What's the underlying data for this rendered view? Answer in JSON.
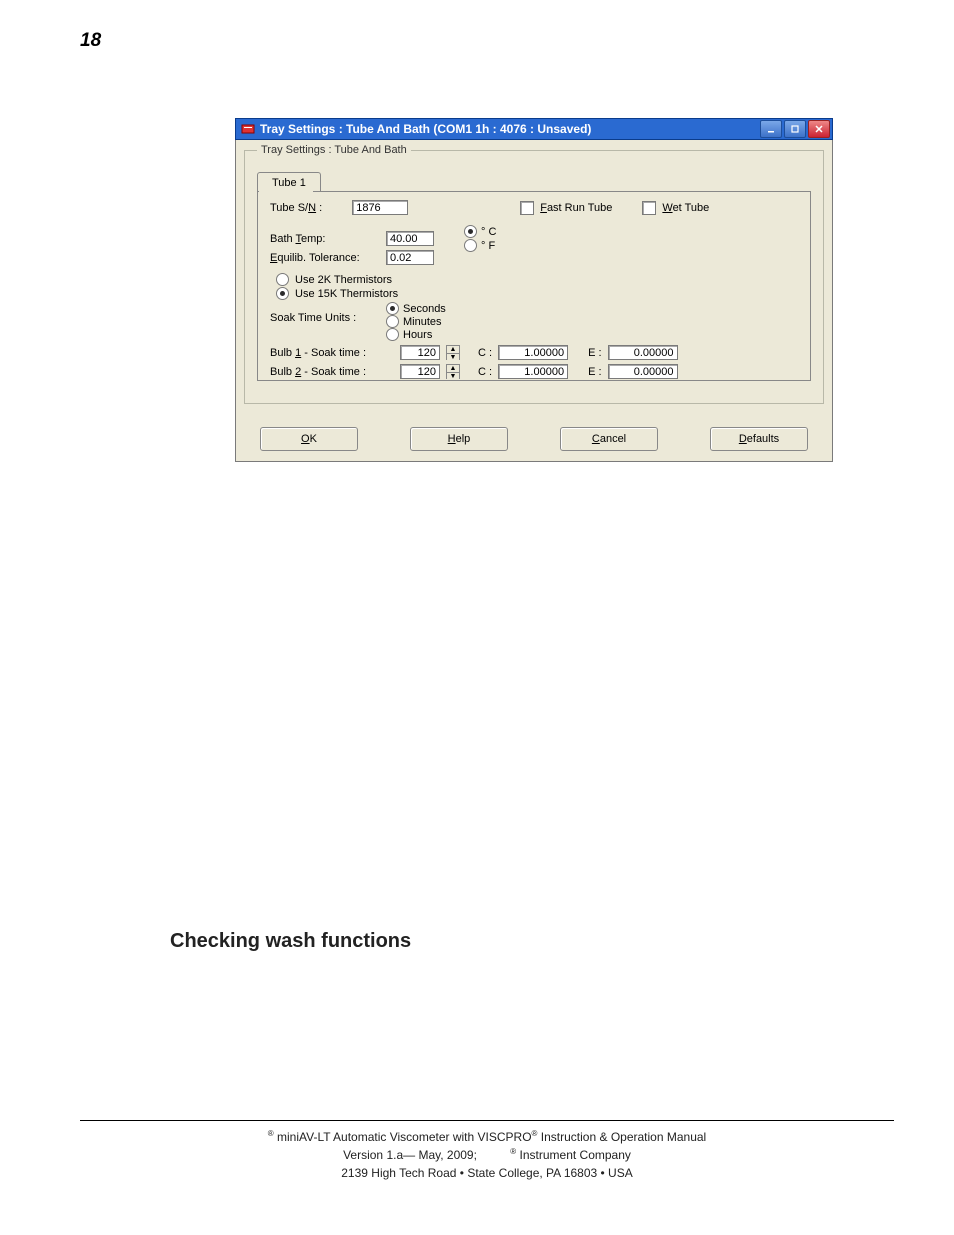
{
  "page_number": "18",
  "window": {
    "title": "Tray Settings : Tube And Bath (COM1 1h : 4076 : Unsaved)"
  },
  "fieldset_legend": "Tray Settings : Tube And Bath",
  "tab_label": "Tube 1",
  "tube_sn": {
    "label_plain": "Tube S/",
    "label_u": "N",
    "label_after": " :",
    "value": "1876"
  },
  "fast_run": {
    "u": "F",
    "rest": "ast Run Tube"
  },
  "wet_tube": {
    "u": "W",
    "rest": "et Tube"
  },
  "bath_temp": {
    "label_pre": "Bath ",
    "u": "T",
    "label_post": "emp:",
    "value": "40.00"
  },
  "temp_unit_c": "° C",
  "temp_unit_f": "° F",
  "equilib": {
    "u": "E",
    "rest": "quilib. Tolerance:",
    "value": "0.02"
  },
  "therm_2k": "Use 2K Thermistors",
  "therm_15k": "Use 15K Thermistors",
  "soak_units_label": "Soak Time Units :",
  "soak_units": {
    "seconds": "Seconds",
    "minutes": "Minutes",
    "hours": "Hours"
  },
  "bulb1": {
    "label_pre": "Bulb ",
    "u": "1",
    "label_post": " -  Soak time  :",
    "time": "120",
    "c": "1.00000",
    "e": "0.00000"
  },
  "bulb2": {
    "label_pre": "Bulb ",
    "u": "2",
    "label_post": " -  Soak time  :",
    "time": "120",
    "c": "1.00000",
    "e": "0.00000"
  },
  "c_label": "C :",
  "e_label": "E :",
  "buttons": {
    "ok": {
      "u": "O",
      "rest": "K"
    },
    "help": {
      "u": "H",
      "rest": "elp"
    },
    "cancel": {
      "u": "C",
      "rest": "ancel"
    },
    "defaults": {
      "u": "D",
      "rest": "efaults"
    }
  },
  "section_heading": "Checking wash functions",
  "footer": {
    "l1a": " miniAV-LT Automatic Viscometer with VISCPRO",
    "l1b": " Instruction & Operation Manual",
    "l2a": "Version 1.a— May, 2009;",
    "l2b": " Instrument Company",
    "l3": "2139 High Tech Road • State College, PA  16803 • USA"
  }
}
